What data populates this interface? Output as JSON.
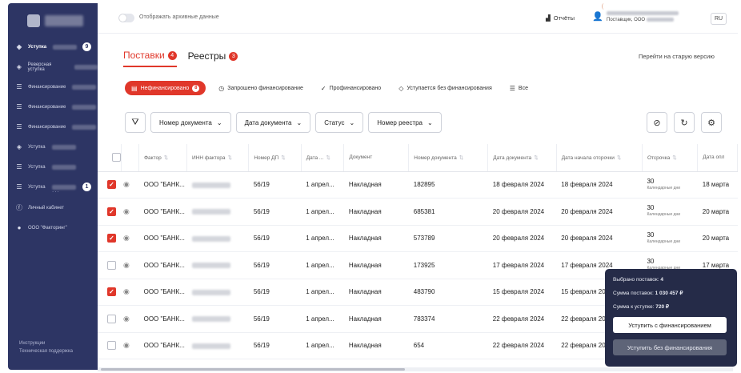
{
  "sidebar": {
    "items": [
      {
        "label": "Уступка",
        "badge": "9",
        "icon": "handshake-icon"
      },
      {
        "label": "Реверсная уступка",
        "badge": "",
        "icon": "handshake-icon"
      },
      {
        "label": "Финансирование",
        "badge": "",
        "icon": "list-icon"
      },
      {
        "label": "Финансирование",
        "badge": "",
        "icon": "list-icon"
      },
      {
        "label": "Финансирование",
        "badge": "",
        "icon": "list-icon"
      },
      {
        "label": "Уступка",
        "badge": "",
        "icon": "handshake-icon"
      },
      {
        "label": "Уступка",
        "badge": "",
        "icon": "list-icon"
      },
      {
        "label": "Уступка",
        "badge": "1",
        "icon": "list-icon"
      }
    ],
    "more": "...",
    "cabinet_label": "Личный кабинет",
    "org_label": "ООО \"Факторинг\"",
    "footer_instructions": "Инструкции",
    "footer_support": "Техническая поддержка"
  },
  "topbar": {
    "archive_toggle_label": "Отображать архивные данные",
    "reports_label": "Отчёты",
    "user_role": "Поставщик, ООО",
    "lang": "RU"
  },
  "tabs": [
    {
      "label": "Поставки",
      "count": "4"
    },
    {
      "label": "Реестры",
      "count": "3"
    }
  ],
  "old_version_link": "Перейти на старую версию",
  "status_filters": [
    {
      "label": "Нефинансировано",
      "count": "8"
    },
    {
      "label": "Запрошено финансирование"
    },
    {
      "label": "Профинансировано"
    },
    {
      "label": "Уступается без финансирования"
    },
    {
      "label": "Все"
    }
  ],
  "filters": [
    {
      "label": "Номер документа"
    },
    {
      "label": "Дата документа"
    },
    {
      "label": "Статус"
    },
    {
      "label": "Номер реестра"
    }
  ],
  "table": {
    "columns": [
      "Фактор",
      "ИНН фактора",
      "Номер ДП",
      "Дата ...",
      "Документ",
      "Номер документа",
      "Дата документа",
      "Дата начала отсрочки",
      "Отсрочка",
      "Дата опл"
    ],
    "defer_unit": "Календарные дни",
    "rows": [
      {
        "checked": true,
        "factor": "ООО \"БАНК...",
        "dp": "56/19",
        "dp_date": "1 апрел...",
        "doc": "Накладная",
        "doc_num": "182895",
        "doc_date": "18 февраля 2024",
        "defer_start": "18 февраля 2024",
        "defer_days": "30",
        "pay_date": "18 марта"
      },
      {
        "checked": true,
        "factor": "ООО \"БАНК...",
        "dp": "56/19",
        "dp_date": "1 апрел...",
        "doc": "Накладная",
        "doc_num": "685381",
        "doc_date": "20 февраля 2024",
        "defer_start": "20 февраля 2024",
        "defer_days": "30",
        "pay_date": "20 марта"
      },
      {
        "checked": true,
        "factor": "ООО \"БАНК...",
        "dp": "56/19",
        "dp_date": "1 апрел...",
        "doc": "Накладная",
        "doc_num": "573789",
        "doc_date": "20 февраля 2024",
        "defer_start": "20 февраля 2024",
        "defer_days": "30",
        "pay_date": "20 марта"
      },
      {
        "checked": false,
        "factor": "ООО \"БАНК...",
        "dp": "56/19",
        "dp_date": "1 апрел...",
        "doc": "Накладная",
        "doc_num": "173925",
        "doc_date": "17 февраля 2024",
        "defer_start": "17 февраля 2024",
        "defer_days": "30",
        "pay_date": "17 марта"
      },
      {
        "checked": true,
        "factor": "ООО \"БАНК...",
        "dp": "56/19",
        "dp_date": "1 апрел...",
        "doc": "Накладная",
        "doc_num": "483790",
        "doc_date": "15 февраля 2024",
        "defer_start": "15 февраля 2024",
        "defer_days": "",
        "pay_date": ""
      },
      {
        "checked": false,
        "factor": "ООО \"БАНК...",
        "dp": "56/19",
        "dp_date": "1 апрел...",
        "doc": "Накладная",
        "doc_num": "783374",
        "doc_date": "22 февраля 2024",
        "defer_start": "22 февраля 2024",
        "defer_days": "",
        "pay_date": ""
      },
      {
        "checked": false,
        "factor": "ООО \"БАНК...",
        "dp": "56/19",
        "dp_date": "1 апрел...",
        "doc": "Накладная",
        "doc_num": "654",
        "doc_date": "22 февраля 2024",
        "defer_start": "22 февраля 2024",
        "defer_days": "",
        "pay_date": ""
      }
    ]
  },
  "summary": {
    "selected_label": "Выбрано поставок:",
    "selected_value": "4",
    "sum_label": "Сумма поставок:",
    "sum_value": "1 030 457 ₽",
    "fee_label": "Сумма к уступке:",
    "fee_value": "720 ₽",
    "btn_with_financing": "Уступить с финансированием",
    "btn_without_financing": "Уступить без финансирования"
  },
  "colors": {
    "accent": "#e0372a",
    "sidebar_bg": "#2d3564",
    "popup_bg": "#252b48"
  }
}
